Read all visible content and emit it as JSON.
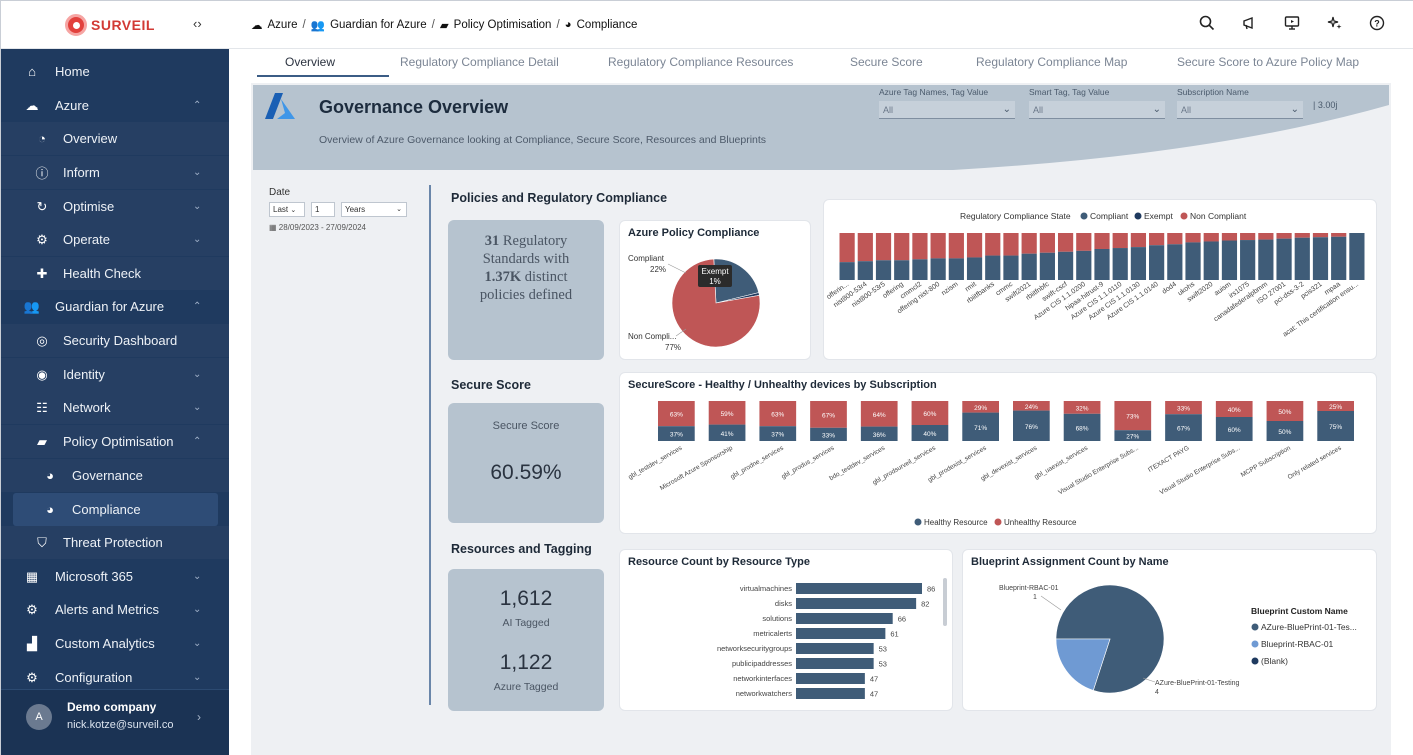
{
  "app": {
    "logo_text": "SURVEIL",
    "collapse_symbol": "‹›"
  },
  "breadcrumb": [
    {
      "label": "Azure",
      "icon": "cloud-icon"
    },
    {
      "label": "Guardian for Azure",
      "icon": "users-icon"
    },
    {
      "label": "Policy Optimisation",
      "icon": "folder-icon"
    },
    {
      "label": "Compliance",
      "icon": "gauge-icon"
    }
  ],
  "sidebar": {
    "items": [
      {
        "label": "Home",
        "icon": "home-icon"
      },
      {
        "label": "Azure",
        "icon": "cloud-icon",
        "chevron": "up"
      },
      {
        "label": "Overview",
        "icon": "pie-chart-icon"
      },
      {
        "label": "Inform",
        "icon": "info-icon",
        "chevron": "down"
      },
      {
        "label": "Optimise",
        "icon": "refresh-icon",
        "chevron": "down"
      },
      {
        "label": "Operate",
        "icon": "settings-icon",
        "chevron": "down"
      },
      {
        "label": "Health Check",
        "icon": "health-icon"
      },
      {
        "label": "Guardian for Azure",
        "icon": "users-icon",
        "chevron": "up"
      },
      {
        "label": "Security Dashboard",
        "icon": "eye-off-icon"
      },
      {
        "label": "Identity",
        "icon": "fingerprint-icon",
        "chevron": "down"
      },
      {
        "label": "Network",
        "icon": "network-icon",
        "chevron": "down"
      },
      {
        "label": "Policy Optimisation",
        "icon": "folder-icon",
        "chevron": "up"
      },
      {
        "label": "Governance",
        "icon": "gauge-icon"
      },
      {
        "label": "Compliance",
        "icon": "gauge-icon"
      },
      {
        "label": "Threat Protection",
        "icon": "shield-hands-icon"
      },
      {
        "label": "Microsoft 365",
        "icon": "microsoft-icon",
        "chevron": "down"
      },
      {
        "label": "Alerts and Metrics",
        "icon": "alert-icon",
        "chevron": "down"
      },
      {
        "label": "Custom Analytics",
        "icon": "analytics-icon",
        "chevron": "down"
      },
      {
        "label": "Configuration",
        "icon": "config-icon",
        "chevron": "down"
      }
    ],
    "profile": {
      "name": "Demo company",
      "email": "nick.kotze@surveil.co",
      "avatar_letter": "A"
    }
  },
  "topbar_icons": [
    "search-icon",
    "megaphone-icon",
    "monitor-icon",
    "sparkle-icon",
    "help-icon"
  ],
  "tabs": [
    "Overview",
    "Regulatory Compliance Detail",
    "Regulatory Compliance Resources",
    "Secure Score",
    "Regulatory Compliance Map",
    "Secure Score to Azure Policy Map"
  ],
  "report": {
    "title": "Governance Overview",
    "subtitle": "Overview of Azure Governance looking at Compliance, Secure Score, Resources and Blueprints",
    "slicers": [
      {
        "label": "Azure Tag Names, Tag Value",
        "value": "All"
      },
      {
        "label": "Smart Tag, Tag Value",
        "value": "All"
      },
      {
        "label": "Subscription Name",
        "value": "All"
      }
    ],
    "version": "| 3.00j",
    "date": {
      "label": "Date",
      "mode": "Last",
      "count": "1",
      "unit": "Years",
      "range": "28/09/2023 - 27/09/2024"
    },
    "policies_section": "Policies and Regulatory Compliance",
    "policy_card": {
      "line1_num": "31",
      "line1_text": " Regulatory",
      "line2": "Standards with",
      "line3_num": "1.37K",
      "line3_text": " distinct",
      "line4": "policies defined"
    },
    "secure_score_section": "Secure Score",
    "secure_score_card": {
      "label": "Secure Score",
      "value": "60.59%"
    },
    "resources_section": "Resources and Tagging",
    "tag_card": {
      "ai_value": "1,612",
      "ai_label": "AI Tagged",
      "azure_value": "1,122",
      "azure_label": "Azure Tagged"
    }
  },
  "colors": {
    "compliant": "#3f5c78",
    "noncompliant": "#bf5656",
    "exempt": "#1f3a5f",
    "blueprint_light": "#6f9ad3",
    "sidebar": "#1f3a5f"
  },
  "chart_data": [
    {
      "type": "pie",
      "title": "Azure Policy Compliance",
      "slices": [
        {
          "label": "Compliant",
          "value": 22,
          "display": "22%"
        },
        {
          "label": "Exempt",
          "value": 1,
          "display": "1%"
        },
        {
          "label": "Non Compli...",
          "value": 77,
          "display": "77%"
        }
      ]
    },
    {
      "type": "bar",
      "stacked": "100%",
      "title": "Regulatory Compliance State",
      "legend": [
        "Compliant",
        "Exempt",
        "Non Compliant"
      ],
      "legend_position": "top",
      "categories": [
        "offerin...",
        "nist800-53r4",
        "nist800-53r5",
        "offering",
        "cmmcl2",
        "offering nist-800",
        "nzism",
        "rmit",
        "rbiitfbanks",
        "cmmc",
        "swift2021",
        "rbiitfnbfc",
        "swift-cscf",
        "Azure CIS 1.1.0200",
        "hipaa-hitrust-9",
        "Azure CIS 1.1.0110",
        "Azure CIS 1.1.0130",
        "Azure CIS 1.1.0140",
        "dod4",
        "ukohs",
        "swift2020",
        "auism",
        "irs1075",
        "canadafederalpbmm",
        "ISO 27001",
        "pci-dss-3-2",
        "pcis321",
        "mpaa",
        "acat: This certification ensu..."
      ],
      "compliant_pct": [
        38,
        40,
        42,
        42,
        44,
        46,
        46,
        48,
        52,
        52,
        56,
        58,
        60,
        62,
        66,
        68,
        70,
        74,
        76,
        80,
        82,
        84,
        85,
        86,
        88,
        90,
        91,
        92,
        100
      ],
      "noncompliant_pct": [
        62,
        60,
        58,
        58,
        56,
        54,
        54,
        52,
        48,
        48,
        44,
        42,
        40,
        38,
        34,
        32,
        30,
        26,
        24,
        20,
        18,
        16,
        15,
        14,
        12,
        10,
        9,
        8,
        0
      ]
    },
    {
      "type": "bar",
      "stacked": "100%",
      "title": "SecureScore - Healthy / Unhealthy devices by Subscription",
      "legend": [
        "Healthy Resource",
        "Unhealthy Resource"
      ],
      "legend_position": "bottom",
      "categories": [
        "gbl_testdev_services",
        "Microsoft Azure Sponsorship",
        "gbl_prodne_services",
        "gbl_produs_services",
        "bdo_testdev_services",
        "gbl_prodsurveil_services",
        "gbl_prodexist_services",
        "gbl_devexist_services",
        "gbl_uaexist_services",
        "Visual Studio Enterprise Subs...",
        "ITEXACT PAYG",
        "Visual Studio Enterprise Subs...",
        "MCPP Subscription",
        "Only related services"
      ],
      "healthy": [
        37,
        41,
        37,
        33,
        36,
        40,
        71,
        76,
        68,
        27,
        67,
        60,
        50,
        75
      ],
      "unhealthy": [
        63,
        59,
        63,
        67,
        64,
        60,
        29,
        24,
        32,
        73,
        33,
        40,
        50,
        25
      ]
    },
    {
      "type": "bar",
      "orientation": "horizontal",
      "title": "Resource Count by Resource Type",
      "categories": [
        "virtualmachines",
        "disks",
        "solutions",
        "metricalerts",
        "networksecuritygroups",
        "publicipaddresses",
        "networkinterfaces",
        "networkwatchers"
      ],
      "values": [
        86,
        82,
        66,
        61,
        53,
        53,
        47,
        47
      ]
    },
    {
      "type": "pie",
      "title": "Blueprint Assignment Count by Name",
      "legend_title": "Blueprint Custom Name",
      "legend": [
        "AZure-BluePrint-01-Tes...",
        "Blueprint-RBAC-01",
        "(Blank)"
      ],
      "slices": [
        {
          "label": "AZure-BluePrint-01-Testing",
          "value": 4
        },
        {
          "label": "Blueprint-RBAC-01",
          "value": 1
        }
      ]
    }
  ]
}
